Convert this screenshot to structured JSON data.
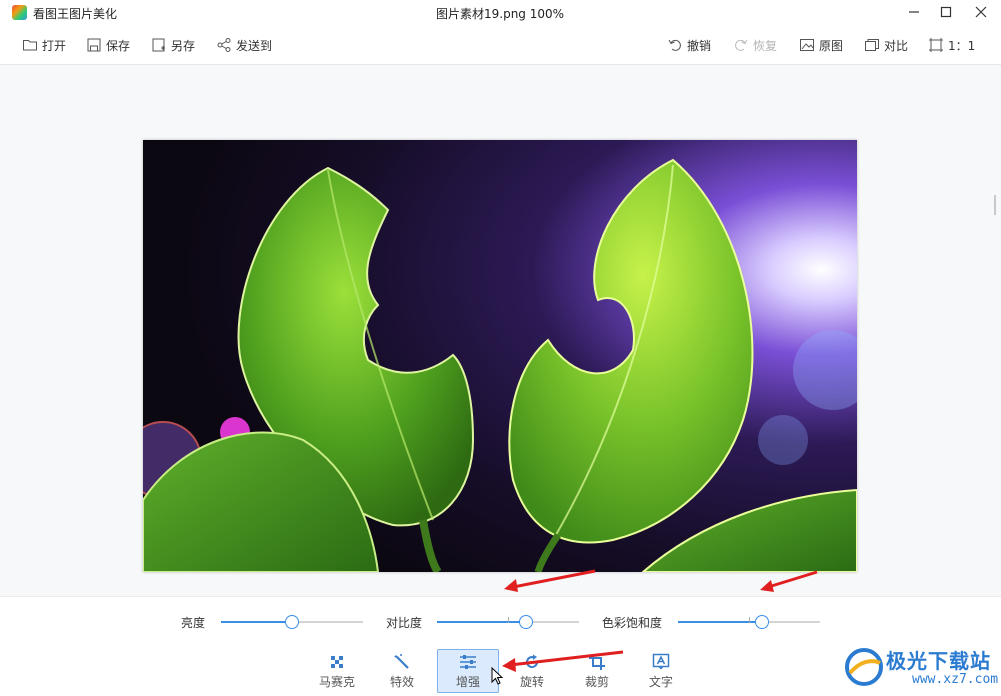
{
  "window": {
    "app_title": "看图王图片美化",
    "doc_title": "图片素材19.png   100%"
  },
  "toolbar": {
    "open": "打开",
    "save": "保存",
    "save_as": "另存",
    "send_to": "发送到",
    "undo": "撤销",
    "redo": "恢复",
    "original": "原图",
    "compare": "对比",
    "ratio": "1：1"
  },
  "adjust": {
    "brightness": {
      "label": "亮度",
      "value": 0.5
    },
    "contrast": {
      "label": "对比度",
      "value": 0.63
    },
    "saturation": {
      "label": "色彩饱和度",
      "value": 0.59
    }
  },
  "tools": {
    "mosaic": "马赛克",
    "effects": "特效",
    "enhance": "增强",
    "rotate": "旋转",
    "crop": "裁剪",
    "text": "文字"
  },
  "colors": {
    "accent": "#3a8ee6",
    "annotation_arrow": "#e02020",
    "active_tool_bg": "#dbeafc"
  },
  "watermark": {
    "name": "极光下载站",
    "url": "www.xz7.com"
  }
}
